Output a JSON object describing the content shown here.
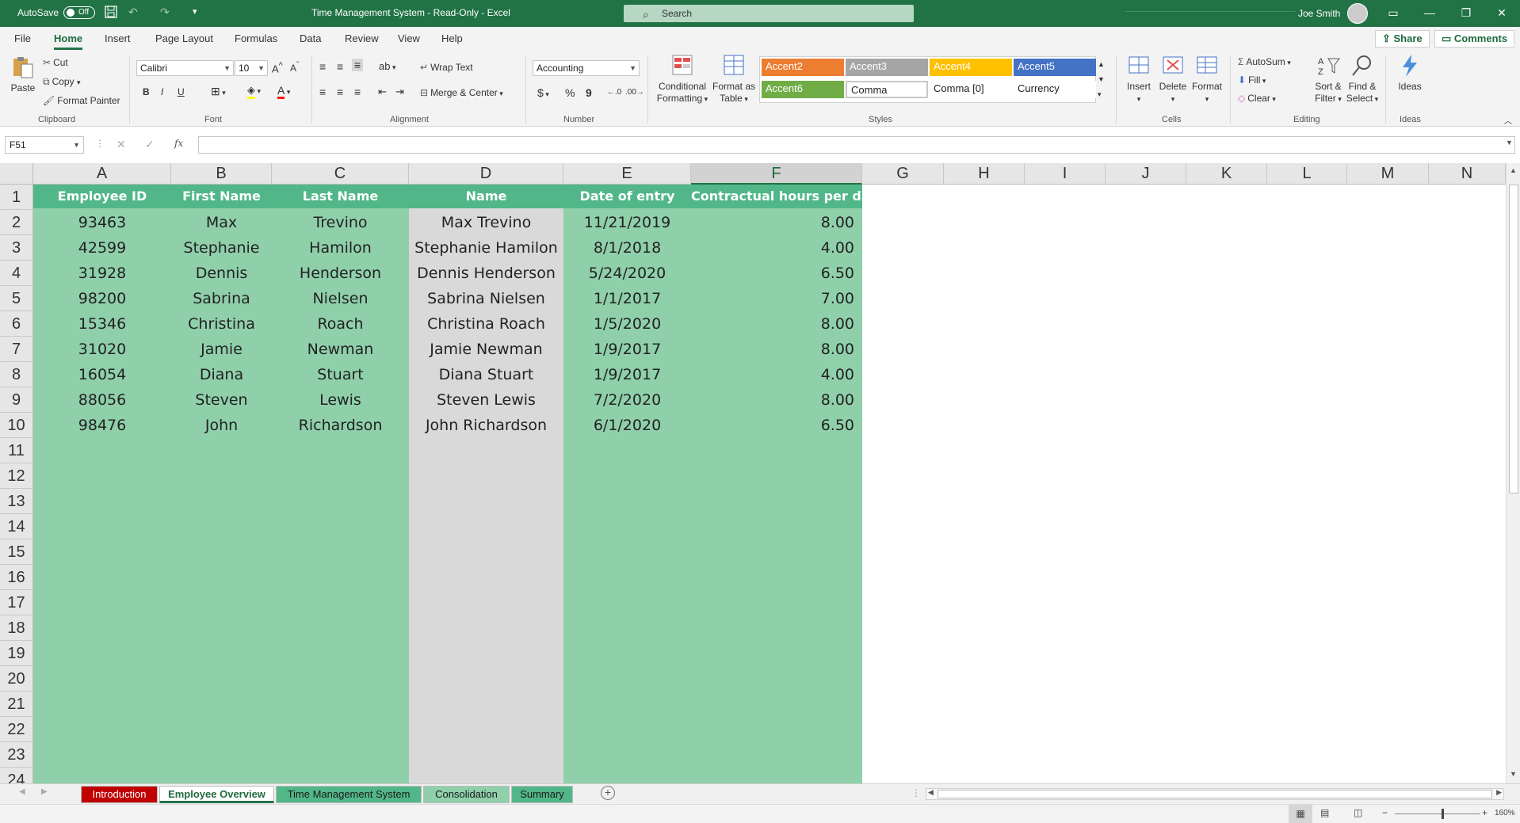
{
  "titlebar": {
    "autosave_label": "AutoSave",
    "autosave_state": "Off",
    "doc_title": "Time Management System  -  Read-Only  -  Excel",
    "search_placeholder": "Search",
    "user_name": "Joe Smith",
    "color": "#217346"
  },
  "tabs": {
    "items": [
      "File",
      "Home",
      "Insert",
      "Page Layout",
      "Formulas",
      "Data",
      "Review",
      "View",
      "Help"
    ],
    "active": "Home",
    "share": "Share",
    "comments": "Comments"
  },
  "ribbon": {
    "clipboard": {
      "paste": "Paste",
      "cut": "Cut",
      "copy": "Copy",
      "format_painter": "Format Painter",
      "label": "Clipboard"
    },
    "font": {
      "font_name": "Calibri",
      "font_size": "10",
      "bold": "B",
      "italic": "I",
      "underline": "U",
      "label": "Font"
    },
    "alignment": {
      "wrap_text": "Wrap Text",
      "merge_center": "Merge & Center",
      "label": "Alignment"
    },
    "number": {
      "format": "Accounting",
      "currency": "$",
      "percent": "%",
      "comma": "9",
      "label": "Number"
    },
    "styles": {
      "conditional_formatting": [
        "Conditional",
        "Formatting"
      ],
      "format_as_table": [
        "Format as",
        "Table"
      ],
      "cells": [
        {
          "name": "Accent2",
          "bg": "#ed7d31",
          "fg": "#ffffff"
        },
        {
          "name": "Accent3",
          "bg": "#a5a5a5",
          "fg": "#ffffff"
        },
        {
          "name": "Accent4",
          "bg": "#ffc000",
          "fg": "#ffffff"
        },
        {
          "name": "Accent5",
          "bg": "#4472c4",
          "fg": "#ffffff"
        },
        {
          "name": "Accent6",
          "bg": "#70ad47",
          "fg": "#ffffff"
        },
        {
          "name": "Comma",
          "bg": "#ffffff",
          "fg": "#222222"
        },
        {
          "name": "Comma [0]",
          "bg": "#ffffff",
          "fg": "#222222"
        },
        {
          "name": "Currency",
          "bg": "#ffffff",
          "fg": "#222222"
        }
      ],
      "label": "Styles"
    },
    "cells": {
      "insert": "Insert",
      "delete": "Delete",
      "format": "Format",
      "label": "Cells"
    },
    "editing": {
      "autosum": "AutoSum",
      "fill": "Fill",
      "clear": "Clear",
      "sort_filter": [
        "Sort &",
        "Filter"
      ],
      "find_select": [
        "Find &",
        "Select"
      ],
      "label": "Editing"
    },
    "ideas": {
      "ideas": "Ideas",
      "label": "Ideas"
    }
  },
  "formula_bar": {
    "name_box": "F51",
    "fx": "fx",
    "value": ""
  },
  "sheet": {
    "columns": [
      "A",
      "B",
      "C",
      "D",
      "E",
      "F",
      "G",
      "H",
      "I",
      "J",
      "K",
      "L",
      "M",
      "N"
    ],
    "selected_column": "F",
    "row_numbers": [
      "1",
      "2",
      "3",
      "4",
      "5",
      "6",
      "7",
      "8",
      "9",
      "10",
      "11",
      "12",
      "13",
      "14",
      "15",
      "16",
      "17",
      "18",
      "19",
      "20",
      "21",
      "22",
      "23",
      "24"
    ],
    "headers": [
      "Employee ID",
      "First Name",
      "Last Name",
      "Name",
      "Date of entry",
      "Contractual hours per day"
    ],
    "rows": [
      [
        "93463",
        "Max",
        "Trevino",
        "Max Trevino",
        "11/21/2019",
        "8.00"
      ],
      [
        "42599",
        "Stephanie",
        "Hamilon",
        "Stephanie Hamilon",
        "8/1/2018",
        "4.00"
      ],
      [
        "31928",
        "Dennis",
        "Henderson",
        "Dennis Henderson",
        "5/24/2020",
        "6.50"
      ],
      [
        "98200",
        "Sabrina",
        "Nielsen",
        "Sabrina Nielsen",
        "1/1/2017",
        "7.00"
      ],
      [
        "15346",
        "Christina",
        "Roach",
        "Christina Roach",
        "1/5/2020",
        "8.00"
      ],
      [
        "31020",
        "Jamie",
        "Newman",
        "Jamie Newman",
        "1/9/2017",
        "8.00"
      ],
      [
        "16054",
        "Diana",
        "Stuart",
        "Diana Stuart",
        "1/9/2017",
        "4.00"
      ],
      [
        "88056",
        "Steven",
        "Lewis",
        "Steven Lewis",
        "7/2/2020",
        "8.00"
      ],
      [
        "98476",
        "John",
        "Richardson",
        "John Richardson",
        "6/1/2020",
        "6.50"
      ]
    ],
    "colors": {
      "header_green": "#52b788",
      "data_green": "#8fd0ab",
      "name_gray": "#d9d9d9"
    }
  },
  "sheet_tabs": [
    {
      "label": "Introduction",
      "bg": "#c00000",
      "fg": "#ffffff"
    },
    {
      "label": "Employee Overview",
      "bg": "#ffffff",
      "fg": "#1e6b3c",
      "active": true
    },
    {
      "label": "Time Management System",
      "bg": "#52b788",
      "fg": "#1a1a1a"
    },
    {
      "label": "Consolidation",
      "bg": "#8fd0ab",
      "fg": "#1a1a1a"
    },
    {
      "label": "Summary",
      "bg": "#52b788",
      "fg": "#1a1a1a"
    }
  ],
  "statusbar": {
    "zoom": "160%"
  }
}
